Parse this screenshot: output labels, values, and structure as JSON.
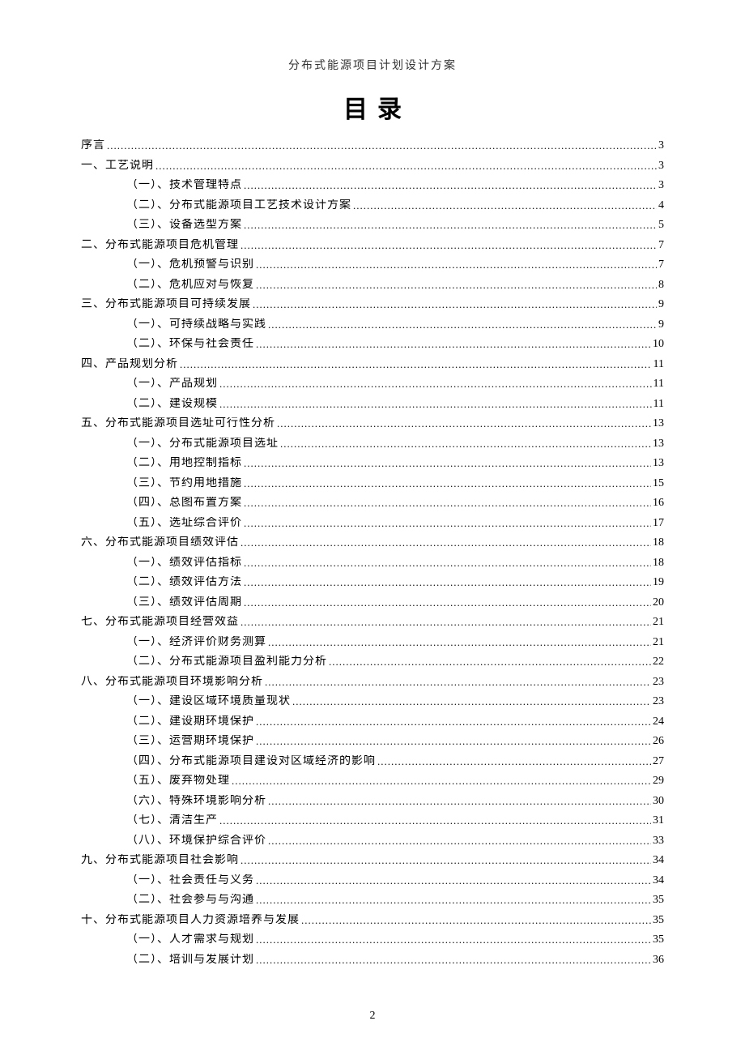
{
  "header": "分布式能源项目计划设计方案",
  "title": "目录",
  "pageNumber": "2",
  "toc": [
    {
      "level": 1,
      "label": "序言",
      "page": "3"
    },
    {
      "level": 1,
      "label": "一、工艺说明",
      "page": "3"
    },
    {
      "level": 2,
      "label": "（一）、技术管理特点",
      "page": "3"
    },
    {
      "level": 2,
      "label": "（二）、分布式能源项目工艺技术设计方案",
      "page": "4"
    },
    {
      "level": 2,
      "label": "（三）、设备选型方案",
      "page": "5"
    },
    {
      "level": 1,
      "label": "二、分布式能源项目危机管理",
      "page": "7"
    },
    {
      "level": 2,
      "label": "（一）、危机预警与识别",
      "page": "7"
    },
    {
      "level": 2,
      "label": "（二）、危机应对与恢复",
      "page": "8"
    },
    {
      "level": 1,
      "label": "三、分布式能源项目可持续发展",
      "page": "9"
    },
    {
      "level": 2,
      "label": "（一）、可持续战略与实践",
      "page": "9"
    },
    {
      "level": 2,
      "label": "（二）、环保与社会责任",
      "page": "10"
    },
    {
      "level": 1,
      "label": "四、产品规划分析",
      "page": "11"
    },
    {
      "level": 2,
      "label": "（一）、产品规划",
      "page": "11"
    },
    {
      "level": 2,
      "label": "（二）、建设规模",
      "page": "11"
    },
    {
      "level": 1,
      "label": "五、分布式能源项目选址可行性分析",
      "page": "13"
    },
    {
      "level": 2,
      "label": "（一）、分布式能源项目选址",
      "page": "13"
    },
    {
      "level": 2,
      "label": "（二）、用地控制指标",
      "page": "13"
    },
    {
      "level": 2,
      "label": "（三）、节约用地措施",
      "page": "15"
    },
    {
      "level": 2,
      "label": "（四）、总图布置方案",
      "page": "16"
    },
    {
      "level": 2,
      "label": "（五）、选址综合评价",
      "page": "17"
    },
    {
      "level": 1,
      "label": "六、分布式能源项目绩效评估",
      "page": "18"
    },
    {
      "level": 2,
      "label": "（一）、绩效评估指标",
      "page": "18"
    },
    {
      "level": 2,
      "label": "（二）、绩效评估方法",
      "page": "19"
    },
    {
      "level": 2,
      "label": "（三）、绩效评估周期",
      "page": "20"
    },
    {
      "level": 1,
      "label": "七、分布式能源项目经营效益",
      "page": "21"
    },
    {
      "level": 2,
      "label": "（一）、经济评价财务测算",
      "page": "21"
    },
    {
      "level": 2,
      "label": "（二）、分布式能源项目盈利能力分析",
      "page": "22"
    },
    {
      "level": 1,
      "label": "八、分布式能源项目环境影响分析",
      "page": "23"
    },
    {
      "level": 2,
      "label": "（一）、建设区域环境质量现状",
      "page": "23"
    },
    {
      "level": 2,
      "label": "（二）、建设期环境保护",
      "page": "24"
    },
    {
      "level": 2,
      "label": "（三）、运营期环境保护",
      "page": "26"
    },
    {
      "level": 2,
      "label": "（四）、分布式能源项目建设对区域经济的影响",
      "page": "27"
    },
    {
      "level": 2,
      "label": "（五）、废弃物处理",
      "page": "29"
    },
    {
      "level": 2,
      "label": "（六）、特殊环境影响分析",
      "page": "30"
    },
    {
      "level": 2,
      "label": "（七）、清洁生产",
      "page": "31"
    },
    {
      "level": 2,
      "label": "（八）、环境保护综合评价",
      "page": "33"
    },
    {
      "level": 1,
      "label": "九、分布式能源项目社会影响",
      "page": "34"
    },
    {
      "level": 2,
      "label": "（一）、社会责任与义务",
      "page": "34"
    },
    {
      "level": 2,
      "label": "（二）、社会参与与沟通",
      "page": "35"
    },
    {
      "level": 1,
      "label": "十、分布式能源项目人力资源培养与发展",
      "page": "35"
    },
    {
      "level": 2,
      "label": "（一）、人才需求与规划",
      "page": "35"
    },
    {
      "level": 2,
      "label": "（二）、培训与发展计划",
      "page": "36"
    }
  ]
}
